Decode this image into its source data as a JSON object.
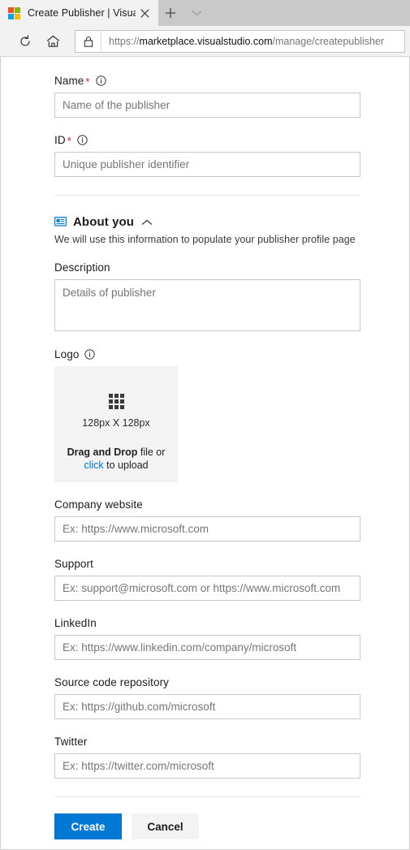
{
  "browser": {
    "tab": {
      "title": "Create Publisher | Visua",
      "favicon": "microsoft-logo",
      "close_label": "Close tab"
    },
    "new_tab_label": "New tab",
    "tab_list_label": "Tab actions menu",
    "toolbar": {
      "refresh_label": "Refresh",
      "home_label": "Home",
      "lock_label": "Site information",
      "url_scheme": "https://",
      "url_host": "marketplace.visualstudio.com",
      "url_path": "/manage/createpublisher"
    }
  },
  "form": {
    "name": {
      "label": "Name",
      "required": "*",
      "placeholder": "Name of the publisher",
      "value": ""
    },
    "id": {
      "label": "ID",
      "required": "*",
      "placeholder": "Unique publisher identifier",
      "value": ""
    },
    "about_section": {
      "title": "About you",
      "subtitle": "We will use this information to populate your publisher profile page",
      "icon": "profile-card-icon",
      "collapse_icon": "chevron-up-icon"
    },
    "description": {
      "label": "Description",
      "placeholder": "Details of publisher",
      "value": ""
    },
    "logo": {
      "label": "Logo",
      "dimensions": "128px X 128px",
      "drag_strong": "Drag and Drop",
      "drag_rest": " file or",
      "click_link": "click",
      "click_rest": " to upload"
    },
    "company_website": {
      "label": "Company website",
      "placeholder": "Ex: https://www.microsoft.com",
      "value": ""
    },
    "support": {
      "label": "Support",
      "placeholder": "Ex: support@microsoft.com or https://www.microsoft.com",
      "value": ""
    },
    "linkedin": {
      "label": "LinkedIn",
      "placeholder": "Ex: https://www.linkedin.com/company/microsoft",
      "value": ""
    },
    "source_repo": {
      "label": "Source code repository",
      "placeholder": "Ex: https://github.com/microsoft",
      "value": ""
    },
    "twitter": {
      "label": "Twitter",
      "placeholder": "Ex: https://twitter.com/microsoft",
      "value": ""
    },
    "actions": {
      "create_label": "Create",
      "cancel_label": "Cancel"
    }
  },
  "colors": {
    "accent": "#0078d4",
    "required_red": "#e81123",
    "section_icon_blue": "#0078d4",
    "dropzone_bg": "#f3f3f3"
  }
}
